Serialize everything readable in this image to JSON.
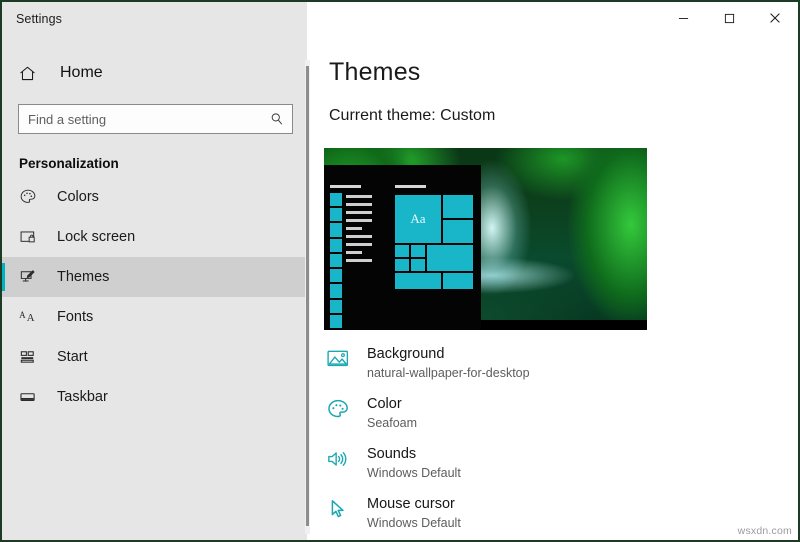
{
  "window": {
    "title": "Settings",
    "controls": [
      {
        "name": "minimize",
        "glyph": "─"
      },
      {
        "name": "maximize",
        "glyph": "☐"
      },
      {
        "name": "close",
        "glyph": "✕"
      }
    ]
  },
  "sidebar": {
    "home_label": "Home",
    "home_icon": "home-icon",
    "search": {
      "placeholder": "Find a setting",
      "value": "",
      "icon": "search-icon"
    },
    "group_title": "Personalization",
    "items": [
      {
        "label": "Colors",
        "icon": "palette-icon",
        "selected": false
      },
      {
        "label": "Lock screen",
        "icon": "lock-screen-icon",
        "selected": false
      },
      {
        "label": "Themes",
        "icon": "themes-icon",
        "selected": true
      },
      {
        "label": "Fonts",
        "icon": "fonts-icon",
        "selected": false
      },
      {
        "label": "Start",
        "icon": "start-icon",
        "selected": false
      },
      {
        "label": "Taskbar",
        "icon": "taskbar-icon",
        "selected": false
      }
    ]
  },
  "main": {
    "page_title": "Themes",
    "current_theme_label": "Current theme: Custom",
    "preview": {
      "name": "theme-preview",
      "description": "Waterfall wallpaper with dark Start menu and teal tiles",
      "tile_text": "Aa"
    },
    "settings": [
      {
        "name": "Background",
        "value": "natural-wallpaper-for-desktop",
        "icon": "picture-icon"
      },
      {
        "name": "Color",
        "value": "Seafoam",
        "icon": "palette-icon"
      },
      {
        "name": "Sounds",
        "value": "Windows Default",
        "icon": "speaker-icon"
      },
      {
        "name": "Mouse cursor",
        "value": "Windows Default",
        "icon": "cursor-icon"
      }
    ]
  },
  "watermark": "wsxdn.com",
  "colors": {
    "accent_teal": "#00b3be",
    "sidebar_bg": "#e6e6e6",
    "selected_bg": "#cfcfcf",
    "tile_teal": "#18b6c8",
    "icon_teal": "#1ba7b3"
  }
}
